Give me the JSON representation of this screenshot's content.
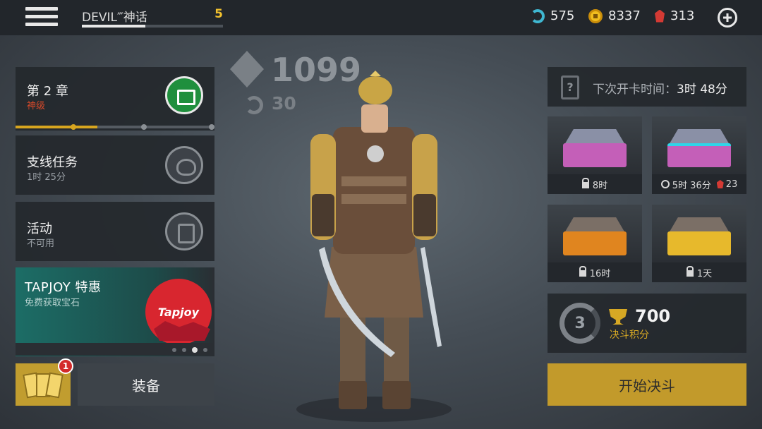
{
  "topbar": {
    "player_name": "DEVIL‴神话",
    "player_level": "5",
    "xp_progress": 0.45,
    "currencies": [
      {
        "icon": "energy-spin-icon",
        "value": "575",
        "color": "#3fb7d1"
      },
      {
        "icon": "gold-coin-icon",
        "value": "8337",
        "color": "#f0bd1f"
      },
      {
        "icon": "ruby-gem-icon",
        "value": "313",
        "color": "#d33a34"
      }
    ]
  },
  "left": {
    "chapter": {
      "title": "第 2 章",
      "subtitle": "神级",
      "progress": 0.41
    },
    "side_quest": {
      "title": "支线任务",
      "subtitle": "1时 25分"
    },
    "event": {
      "title": "活动",
      "subtitle": "不可用"
    },
    "tapjoy": {
      "title": "TAPJOY 特惠",
      "subtitle": "免费获取宝石",
      "logo_text": "Tapjoy",
      "page_count": 4,
      "active_page": 3
    },
    "cards_badge": "1",
    "equip_label": "装备"
  },
  "center": {
    "power": "1099",
    "sub_power": "30"
  },
  "right": {
    "next_card": {
      "label": "下次开卡时间：",
      "time": "3时 48分"
    },
    "chests": [
      {
        "name": "purple-chest",
        "lock_label": "8时",
        "color": "#c45fb8"
      },
      {
        "name": "purple-cyan-chest",
        "timer_label": "5时 36分",
        "gem_cost": "23",
        "color": "#c45fb8"
      },
      {
        "name": "orange-chest",
        "lock_label": "16时",
        "color": "#e0851f"
      },
      {
        "name": "gold-chest",
        "lock_label": "1天",
        "color": "#e7b92c"
      }
    ],
    "duel": {
      "rank": "3",
      "score": "700",
      "score_label": "决斗积分"
    },
    "start_label": "开始决斗"
  }
}
